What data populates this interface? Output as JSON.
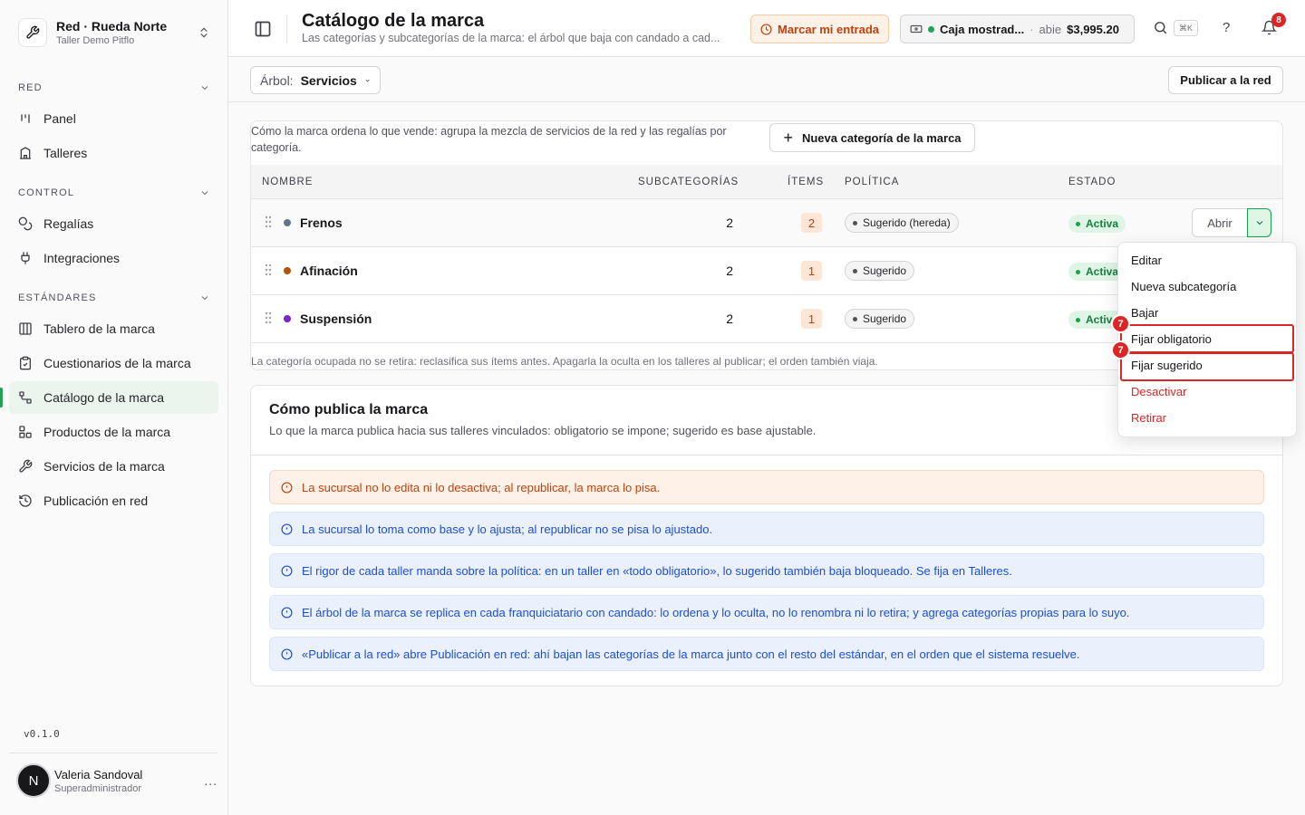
{
  "org": {
    "name": "Red · Rueda Norte",
    "subtitle": "Taller Demo Pitflo"
  },
  "sidebar": {
    "sections": [
      {
        "title": "RED",
        "items": [
          {
            "label": "Panel",
            "icon": "kanban-icon"
          },
          {
            "label": "Talleres",
            "icon": "building-icon"
          }
        ]
      },
      {
        "title": "CONTROL",
        "items": [
          {
            "label": "Regalías",
            "icon": "coins-icon"
          },
          {
            "label": "Integraciones",
            "icon": "plug-icon"
          }
        ]
      },
      {
        "title": "ESTÁNDARES",
        "items": [
          {
            "label": "Tablero de la marca",
            "icon": "columns-icon"
          },
          {
            "label": "Cuestionarios de la marca",
            "icon": "clipboard-icon"
          },
          {
            "label": "Catálogo de la marca",
            "icon": "tree-icon"
          },
          {
            "label": "Productos de la marca",
            "icon": "package-icon"
          },
          {
            "label": "Servicios de la marca",
            "icon": "wrench-icon"
          },
          {
            "label": "Publicación en red",
            "icon": "history-icon"
          }
        ]
      }
    ],
    "active": "Catálogo de la marca"
  },
  "version": "v0.1.0",
  "user": {
    "initial": "N",
    "name": "Valeria Sandoval",
    "role": "Superadministrador",
    "more": "..."
  },
  "header": {
    "title": "Catálogo de la marca",
    "subtitle": "Las categorías y subcategorías de la marca: el árbol que baja con candado a cad...",
    "checkin_label": "Marcar mi entrada",
    "cash": {
      "name": "Caja mostrad...",
      "sep": "·",
      "status": "abie",
      "amount": "$3,995.20"
    },
    "shortcut": "⌘K",
    "help": "?",
    "notifications": "8"
  },
  "toolbar": {
    "tree_label": "Árbol:",
    "tree_value": "Servicios",
    "publish_label": "Publicar a la red"
  },
  "catalog": {
    "description": "Cómo la marca ordena lo que vende: agrupa la mezcla de servicios de la red y las regalías por categoría.",
    "new_category_label": "Nueva categoría de la marca",
    "columns": {
      "name": "NOMBRE",
      "subcategories": "SUBCATEGORÍAS",
      "items": "ÍTEMS",
      "policy": "POLÍTICA",
      "status": "ESTADO"
    },
    "rows": [
      {
        "name": "Frenos",
        "color": "#64748b",
        "subcategories": "2",
        "items": "2",
        "policy": "Sugerido (hereda)",
        "status": "Activa",
        "open": "Abrir"
      },
      {
        "name": "Afinación",
        "color": "#b45309",
        "subcategories": "2",
        "items": "1",
        "policy": "Sugerido",
        "status": "Activa"
      },
      {
        "name": "Suspensión",
        "color": "#7e22ce",
        "subcategories": "2",
        "items": "1",
        "policy": "Sugerido",
        "status": "Activa"
      }
    ],
    "footer": "La categoría ocupada no se retira: reclasifica sus ítems antes. Apagarla la oculta en los talleres al publicar; el orden también viaja."
  },
  "publish": {
    "title": "Cómo publica la marca",
    "subtitle": "Lo que la marca publica hacia sus talleres vinculados: obligatorio se impone; sugerido es base ajustable.",
    "notes": [
      {
        "type": "warn",
        "text": "La sucursal no lo edita ni lo desactiva; al republicar, la marca lo pisa."
      },
      {
        "type": "info",
        "text": "La sucursal lo toma como base y lo ajusta; al republicar no se pisa lo ajustado."
      },
      {
        "type": "info",
        "text": "El rigor de cada taller manda sobre la política: en un taller en «todo obligatorio», lo sugerido también baja bloqueado. Se fija en Talleres."
      },
      {
        "type": "info",
        "text": "El árbol de la marca se replica en cada franquiciatario con candado: lo ordena y lo oculta, no lo renombra ni lo retira; y agrega categorías propias para lo suyo."
      },
      {
        "type": "info",
        "text": "«Publicar a la red» abre Publicación en red: ahí bajan las categorías de la marca junto con el resto del estándar, en el orden que el sistema resuelve."
      }
    ]
  },
  "menu": {
    "items": [
      "Editar",
      "Nueva subcategoría",
      "Bajar",
      "Fijar obligatorio",
      "Fijar sugerido",
      "Desactivar",
      "Retirar"
    ],
    "markers": [
      "7",
      "7"
    ]
  }
}
